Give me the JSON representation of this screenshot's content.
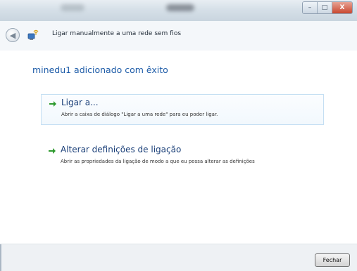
{
  "window": {
    "controls": {
      "minimize": "–",
      "maximize": "□",
      "close": "X"
    }
  },
  "wizard": {
    "title": "Ligar manualmente a uma rede sem fios",
    "back_icon": "back-arrow-icon",
    "network_icon": "wireless-network-icon"
  },
  "main": {
    "heading": "minedu1 adicionado com êxito",
    "options": [
      {
        "title": "Ligar a...",
        "description": "Abrir a caixa de diálogo \"Ligar a uma rede\" para eu poder ligar.",
        "icon": "green-arrow-icon"
      },
      {
        "title": "Alterar definições de ligação",
        "description": "Abrir as propriedades da ligação de modo a que eu possa alterar as definições",
        "icon": "green-arrow-icon"
      }
    ]
  },
  "footer": {
    "close_label": "Fechar"
  },
  "colors": {
    "heading": "#1e5ca8",
    "option_title": "#1a3f78",
    "arrow": "#2e9a2e",
    "footer_bg": "#eef1f4"
  }
}
